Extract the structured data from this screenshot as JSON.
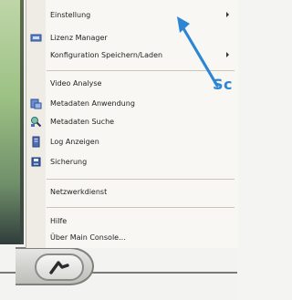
{
  "menu": {
    "groups": [
      [
        {
          "label": "Einstellung",
          "submenu": true,
          "icon": "none"
        },
        {
          "label": "Lizenz Manager",
          "submenu": false,
          "icon": "license-icon"
        },
        {
          "label": "Konfiguration Speichern/Laden",
          "submenu": true,
          "icon": "none"
        }
      ],
      [
        {
          "label": "Video Analyse",
          "submenu": false,
          "icon": "none"
        },
        {
          "label": "Metadaten Anwendung",
          "submenu": false,
          "icon": "metadata-app-icon"
        },
        {
          "label": "Metadaten Suche",
          "submenu": false,
          "icon": "metadata-search-icon"
        },
        {
          "label": "Log Anzeigen",
          "submenu": false,
          "icon": "log-icon"
        },
        {
          "label": "Sicherung",
          "submenu": false,
          "icon": "backup-icon"
        }
      ],
      [
        {
          "label": "Netzwerkdienst",
          "submenu": false,
          "icon": "none"
        }
      ],
      [
        {
          "label": "Hilfe",
          "submenu": false,
          "icon": "none"
        },
        {
          "label": "Über Main Console...",
          "submenu": false,
          "icon": "none"
        }
      ]
    ]
  },
  "annotation": {
    "text": "Sc",
    "color": "#2d86d4"
  },
  "colors": {
    "menu_bg": "#f8f7f3",
    "gutter": "#eeece4",
    "accent": "#2d86d4"
  }
}
